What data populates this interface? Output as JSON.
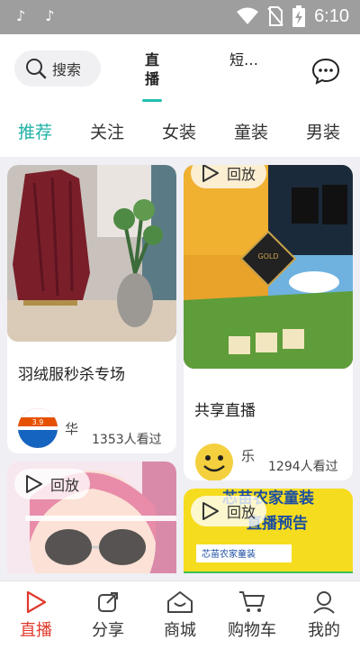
{
  "status_bar": {
    "time": "6:10",
    "icons": [
      "tiktok-icon",
      "tiktok-icon",
      "wifi-icon",
      "no-sim-icon",
      "battery-charging-icon"
    ]
  },
  "header": {
    "search_label": "搜索",
    "tabs": [
      {
        "label": "直播",
        "active": true
      },
      {
        "label": "短…",
        "active": false
      }
    ],
    "message_icon": "chat-bubble-icon",
    "accent_color": "#20c0b0"
  },
  "categories": [
    {
      "label": "推荐",
      "active": true
    },
    {
      "label": "关注",
      "active": false
    },
    {
      "label": "女装",
      "active": false
    },
    {
      "label": "童装",
      "active": false
    },
    {
      "label": "男装",
      "active": false
    }
  ],
  "feed": [
    {
      "title": "羽绒服秒杀专场",
      "channel_initial": "华",
      "viewers": "1353人看过",
      "thumb_replay": null,
      "avatar_text": "3.9"
    },
    {
      "title": "共享直播",
      "channel_initial": "乐",
      "viewers": "1294人看过",
      "thumb_replay": "回放",
      "image_text": "GOLD"
    },
    {
      "thumb_replay": "回放"
    },
    {
      "thumb_replay": "回放",
      "image_text_lines": [
        "芯苗农家童装",
        "直播预告"
      ],
      "image_label": "芯苗农家童装"
    }
  ],
  "tabbar": [
    {
      "label": "直播",
      "icon": "play-triangle-icon",
      "active": true
    },
    {
      "label": "分享",
      "icon": "share-icon",
      "active": false
    },
    {
      "label": "商城",
      "icon": "mall-house-icon",
      "active": false
    },
    {
      "label": "购物车",
      "icon": "cart-icon",
      "active": false
    },
    {
      "label": "我的",
      "icon": "profile-icon",
      "active": false
    }
  ],
  "colors": {
    "active_red": "#e0392b",
    "teal": "#20b2a6"
  }
}
